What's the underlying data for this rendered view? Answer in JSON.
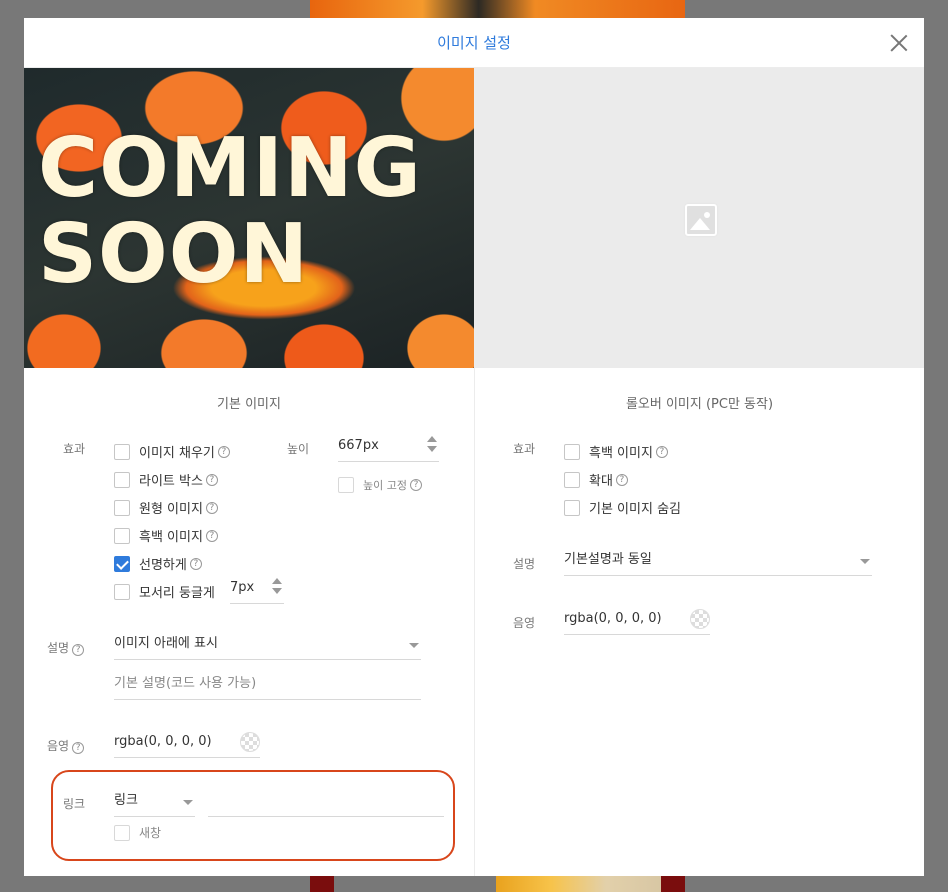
{
  "modal": {
    "title": "이미지 설정"
  },
  "left": {
    "preview_text": [
      "COMING",
      "SOON"
    ],
    "section_title": "기본 이미지",
    "effect_label": "효과",
    "effects": [
      {
        "label": "이미지 채우기",
        "checked": false,
        "help": true
      },
      {
        "label": "라이트 박스",
        "checked": false,
        "help": true
      },
      {
        "label": "원형 이미지",
        "checked": false,
        "help": true
      },
      {
        "label": "흑백 이미지",
        "checked": false,
        "help": true
      },
      {
        "label": "선명하게",
        "checked": true,
        "help": true
      },
      {
        "label": "모서리 둥글게",
        "checked": false,
        "help": false
      }
    ],
    "corner_radius": "7px",
    "height_label": "높이",
    "height_value": "667px",
    "fix_height_label": "높이 고정",
    "desc_label": "설명",
    "desc_select": "이미지 아래에 표시",
    "desc_placeholder": "기본 설명(코드 사용 가능)",
    "shadow_label": "음영",
    "shadow_value": "rgba(0, 0, 0, 0)",
    "link_label": "링크",
    "link_select": "링크",
    "link_value": "",
    "new_window_label": "새창"
  },
  "right": {
    "section_title": "롤오버 이미지 (PC만 동작)",
    "effect_label": "효과",
    "effects": [
      {
        "label": "흑백 이미지",
        "checked": false,
        "help": true
      },
      {
        "label": "확대",
        "checked": false,
        "help": true
      },
      {
        "label": "기본 이미지 숨김",
        "checked": false,
        "help": false
      }
    ],
    "desc_label": "설명",
    "desc_select": "기본설명과 동일",
    "shadow_label": "음영",
    "shadow_value": "rgba(0, 0, 0, 0)"
  },
  "help_glyph": "?",
  "accent_color": "#2f7bdc",
  "highlight_color": "#d8461b"
}
